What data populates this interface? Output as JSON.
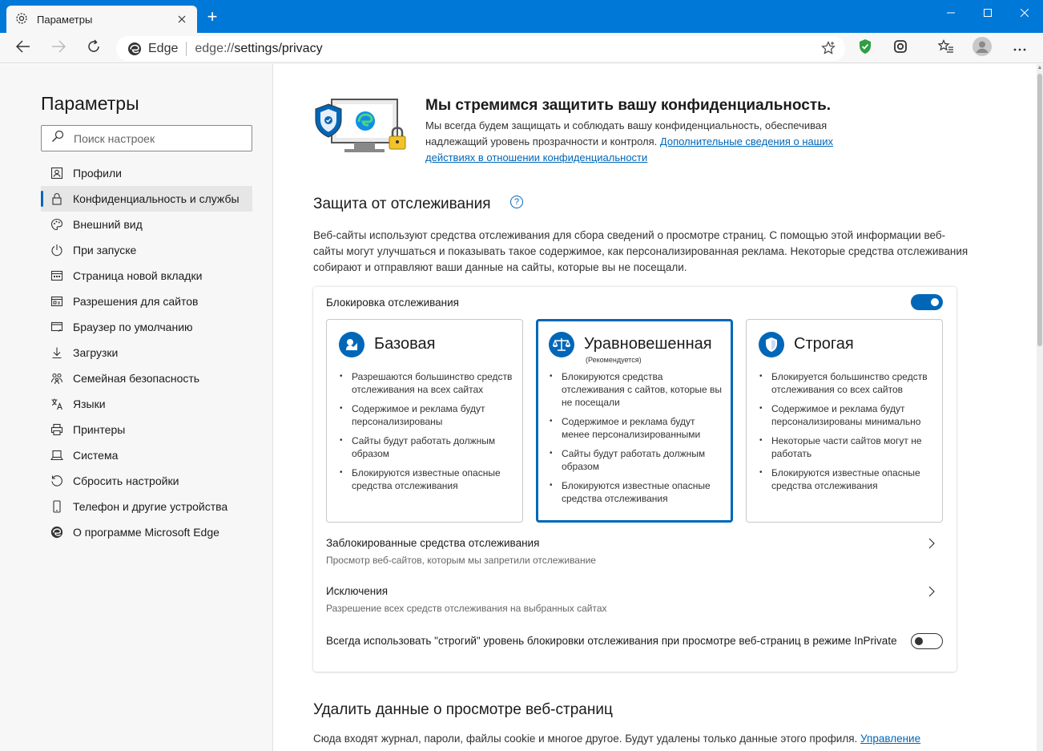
{
  "window": {
    "tab_title": "Параметры",
    "tab_icon": "gear-icon",
    "new_tab_symbol": "+"
  },
  "toolbar": {
    "site_label": "Edge",
    "url_scheme": "edge://",
    "url_path": "settings/privacy"
  },
  "sidebar": {
    "title": "Параметры",
    "search_placeholder": "Поиск настроек",
    "items": [
      {
        "label": "Профили",
        "icon": "profile-icon"
      },
      {
        "label": "Конфиденциальность и службы",
        "icon": "lock-icon",
        "active": true
      },
      {
        "label": "Внешний вид",
        "icon": "palette-icon"
      },
      {
        "label": "При запуске",
        "icon": "power-icon"
      },
      {
        "label": "Страница новой вкладки",
        "icon": "new-tab-page-icon"
      },
      {
        "label": "Разрешения для сайтов",
        "icon": "site-permissions-icon"
      },
      {
        "label": "Браузер по умолчанию",
        "icon": "default-browser-icon"
      },
      {
        "label": "Загрузки",
        "icon": "download-icon"
      },
      {
        "label": "Семейная безопасность",
        "icon": "family-icon"
      },
      {
        "label": "Языки",
        "icon": "languages-icon"
      },
      {
        "label": "Принтеры",
        "icon": "printer-icon"
      },
      {
        "label": "Система",
        "icon": "system-icon"
      },
      {
        "label": "Сбросить настройки",
        "icon": "reset-icon"
      },
      {
        "label": "Телефон и другие устройства",
        "icon": "phone-icon"
      },
      {
        "label": "О программе Microsoft Edge",
        "icon": "edge-logo-icon"
      }
    ]
  },
  "hero": {
    "title": "Мы стремимся защитить вашу конфиденциальность.",
    "text": "Мы всегда будем защищать и соблюдать вашу конфиденциальность, обеспечивая надлежащий уровень прозрачности и контроля. ",
    "link": "Дополнительные сведения о наших действиях в отношении конфиденциальности"
  },
  "tracking": {
    "title": "Защита от отслеживания",
    "help_symbol": "?",
    "description": "Веб-сайты используют средства отслеживания для сбора сведений о просмотре страниц. С помощью этой информации веб-сайты могут улучшаться и показывать такое содержимое, как персонализированная реклама. Некоторые средства отслеживания собирают и отправляют ваши данные на сайты, которые вы не посещали.",
    "block_label": "Блокировка отслеживания",
    "block_enabled": true,
    "options": [
      {
        "name": "Базовая",
        "subtitle": "",
        "icon": "basic-mode-icon",
        "selected": false,
        "bullets": [
          "Разрешаются большинство средств отслеживания на всех сайтах",
          "Содержимое и реклама будут персонализированы",
          "Сайты будут работать должным образом",
          "Блокируются известные опасные средства отслеживания"
        ]
      },
      {
        "name": "Уравновешенная",
        "subtitle": "(Рекомендуется)",
        "icon": "balanced-scale-icon",
        "selected": true,
        "bullets": [
          "Блокируются средства отслеживания с сайтов, которые вы не посещали",
          "Содержимое и реклама будут менее персонализированными",
          "Сайты будут работать должным образом",
          "Блокируются известные опасные средства отслеживания"
        ]
      },
      {
        "name": "Строгая",
        "subtitle": "",
        "icon": "strict-shield-icon",
        "selected": false,
        "bullets": [
          "Блокируется большинство средств отслеживания со всех сайтов",
          "Содержимое и реклама будут персонализированы минимально",
          "Некоторые части сайтов могут не работать",
          "Блокируются известные опасные средства отслеживания"
        ]
      }
    ],
    "blocked_trackers_title": "Заблокированные средства отслеживания",
    "blocked_trackers_desc": "Просмотр веб-сайтов, которым мы запретили отслеживание",
    "exceptions_title": "Исключения",
    "exceptions_desc": "Разрешение всех средств отслеживания на выбранных сайтах",
    "inprivate_label": "Всегда использовать \"строгий\" уровень блокировки отслеживания при просмотре веб-страниц в режиме InPrivate",
    "inprivate_enabled": false
  },
  "clear_data": {
    "title": "Удалить данные о просмотре веб-страниц",
    "description": "Сюда входят журнал, пароли, файлы cookie и многое другое. Будут удалены только данные этого профиля. ",
    "link": "Управление"
  },
  "colors": {
    "accent": "#0067b8",
    "titlebar": "#0078d7"
  }
}
